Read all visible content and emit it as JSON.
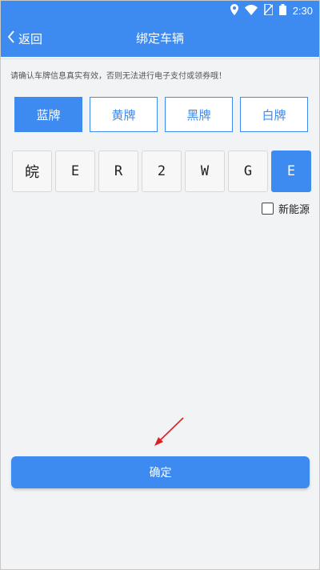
{
  "status_bar": {
    "time": "2:30",
    "icons": [
      "location-icon",
      "wifi-icon",
      "no-sim-icon",
      "battery-icon"
    ]
  },
  "nav": {
    "back_label": "返回",
    "title": "绑定车辆"
  },
  "notice": "请确认车牌信息真实有效，否则无法进行电子支付或领券哦！",
  "plate_types": [
    {
      "label": "蓝牌",
      "active": true
    },
    {
      "label": "黄牌",
      "active": false
    },
    {
      "label": "黑牌",
      "active": false
    },
    {
      "label": "白牌",
      "active": false
    }
  ],
  "plate_chars": [
    "皖",
    "E",
    "R",
    "2",
    "W",
    "G",
    "E"
  ],
  "active_char_index": 6,
  "new_energy": {
    "label": "新能源",
    "checked": false
  },
  "confirm_label": "确定",
  "colors": {
    "accent": "#3d8af0",
    "background": "#f2f3f5",
    "annotation_arrow": "#e02020"
  }
}
